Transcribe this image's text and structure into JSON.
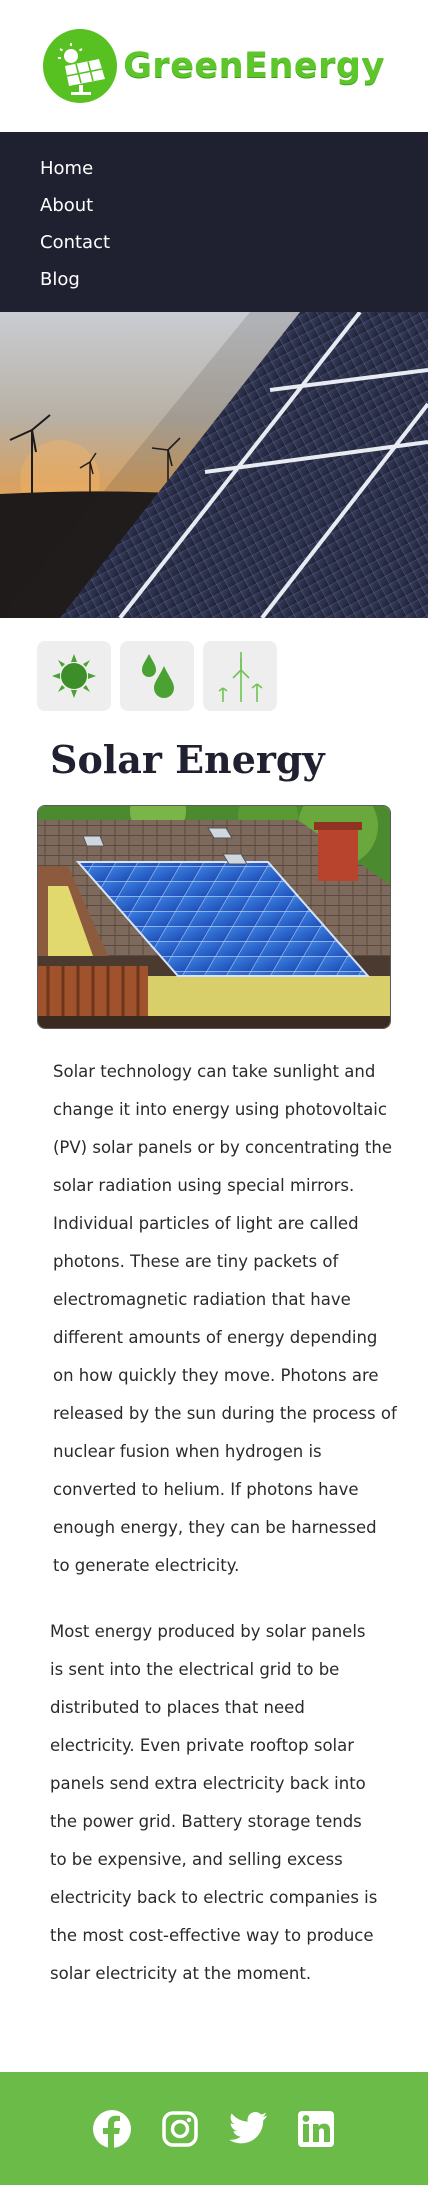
{
  "brand": {
    "name": "GreenEnergy",
    "color": "#5dc62b"
  },
  "nav": {
    "background": "#1f2030",
    "items": [
      "Home",
      "About",
      "Contact",
      "Blog"
    ]
  },
  "icons": [
    "sun-icon",
    "water-drops-icon",
    "wind-turbines-icon"
  ],
  "main": {
    "title": "Solar Energy",
    "paragraph1": "Solar technology can take sunlight and change it into energy using photovoltaic (PV) solar panels or by concentrating the solar radiation using special mirrors. Individual particles of light are called photons. These are tiny packets of electromagnetic radiation that have different amounts of energy depending on how quickly they move. Photons are released by the sun during the process of nuclear fusion when hydrogen is converted to helium. If photons have enough energy, they can be harnessed to generate electricity.",
    "paragraph2": "Most energy produced by solar panels is sent into the electrical grid to be distributed to places that need electricity. Even private rooftop solar panels send extra electricity back into the power grid. Battery storage tends to be expensive, and selling excess electricity back to electric companies is the most cost-effective way to produce solar electricity at the moment."
  },
  "footer": {
    "background": "#6abb48",
    "social": [
      "facebook-icon",
      "instagram-icon",
      "twitter-icon",
      "linkedin-icon"
    ]
  }
}
